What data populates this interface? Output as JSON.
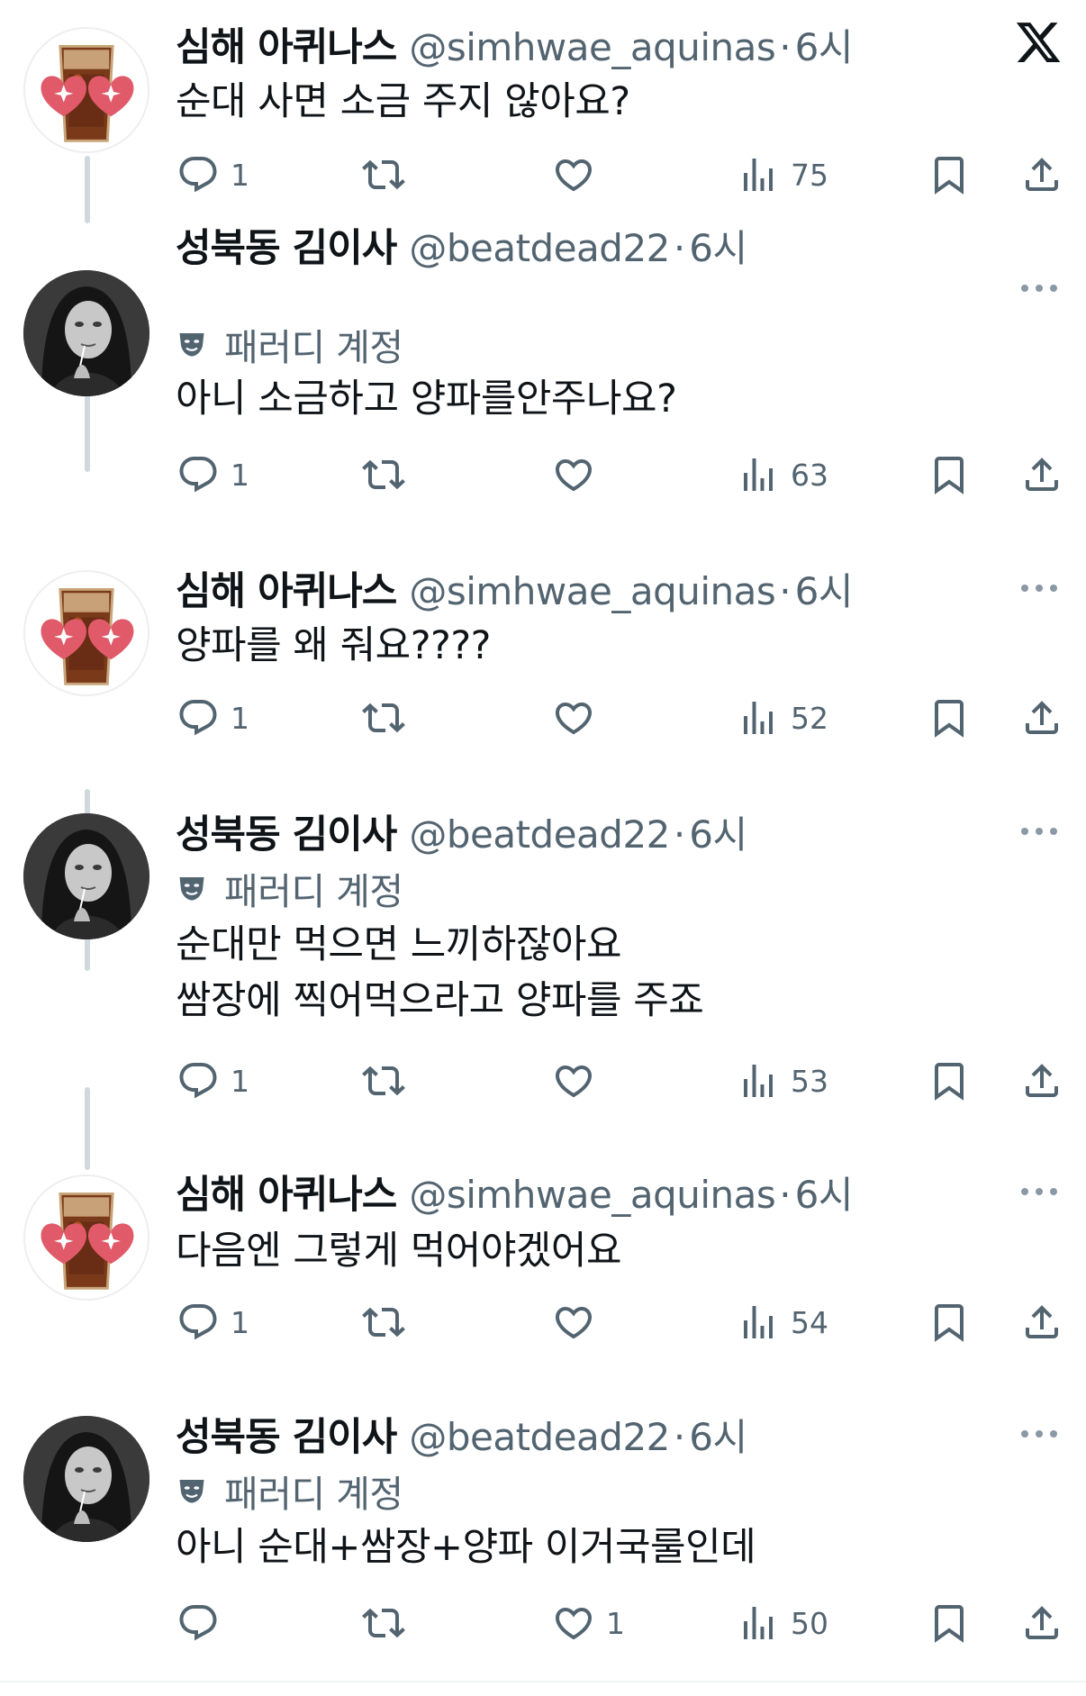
{
  "brand": {
    "logo": "x-logo-icon"
  },
  "users": {
    "simhwae": {
      "display_name": "심해 아퀴나스",
      "handle": "@simhwae_aquinas"
    },
    "beatdead": {
      "display_name": "성북동 김이사",
      "handle": "@beatdead22",
      "badge": "패러디 계정"
    }
  },
  "tweets": [
    {
      "author": "simhwae",
      "display_name": "심해 아퀴나스",
      "handle": "@simhwae_aquinas",
      "time": "6시",
      "lines": [
        "순대 사면 소금 주지 않아요?"
      ],
      "replies": "1",
      "retweets": "",
      "likes": "",
      "views": "75"
    },
    {
      "author": "beatdead",
      "display_name": "성북동 김이사",
      "handle": "@beatdead22",
      "time": "6시",
      "badge": "패러디 계정",
      "lines": [
        "아니 소금하고 양파를안주나요?"
      ],
      "replies": "1",
      "retweets": "",
      "likes": "",
      "views": "63"
    },
    {
      "author": "simhwae",
      "display_name": "심해 아퀴나스",
      "handle": "@simhwae_aquinas",
      "time": "6시",
      "lines": [
        "양파를 왜 줘요????"
      ],
      "replies": "1",
      "retweets": "",
      "likes": "",
      "views": "52"
    },
    {
      "author": "beatdead",
      "display_name": "성북동 김이사",
      "handle": "@beatdead22",
      "time": "6시",
      "badge": "패러디 계정",
      "lines": [
        "순대만 먹으면 느끼하잖아요",
        "쌈장에 찍어먹으라고 양파를 주죠"
      ],
      "replies": "1",
      "retweets": "",
      "likes": "",
      "views": "53"
    },
    {
      "author": "simhwae",
      "display_name": "심해 아퀴나스",
      "handle": "@simhwae_aquinas",
      "time": "6시",
      "lines": [
        "다음엔 그렇게 먹어야겠어요"
      ],
      "replies": "1",
      "retweets": "",
      "likes": "",
      "views": "54"
    },
    {
      "author": "beatdead",
      "display_name": "성북동 김이사",
      "handle": "@beatdead22",
      "time": "6시",
      "badge": "패러디 계정",
      "lines": [
        "아니 순대+쌈장+양파 이거국룰인데"
      ],
      "replies": "",
      "retweets": "",
      "likes": "1",
      "views": "50"
    }
  ],
  "separator": "·",
  "colors": {
    "text": "#0f1419",
    "secondary": "#536471",
    "thread_line": "#cfd9de",
    "heart": "#e0245e"
  }
}
